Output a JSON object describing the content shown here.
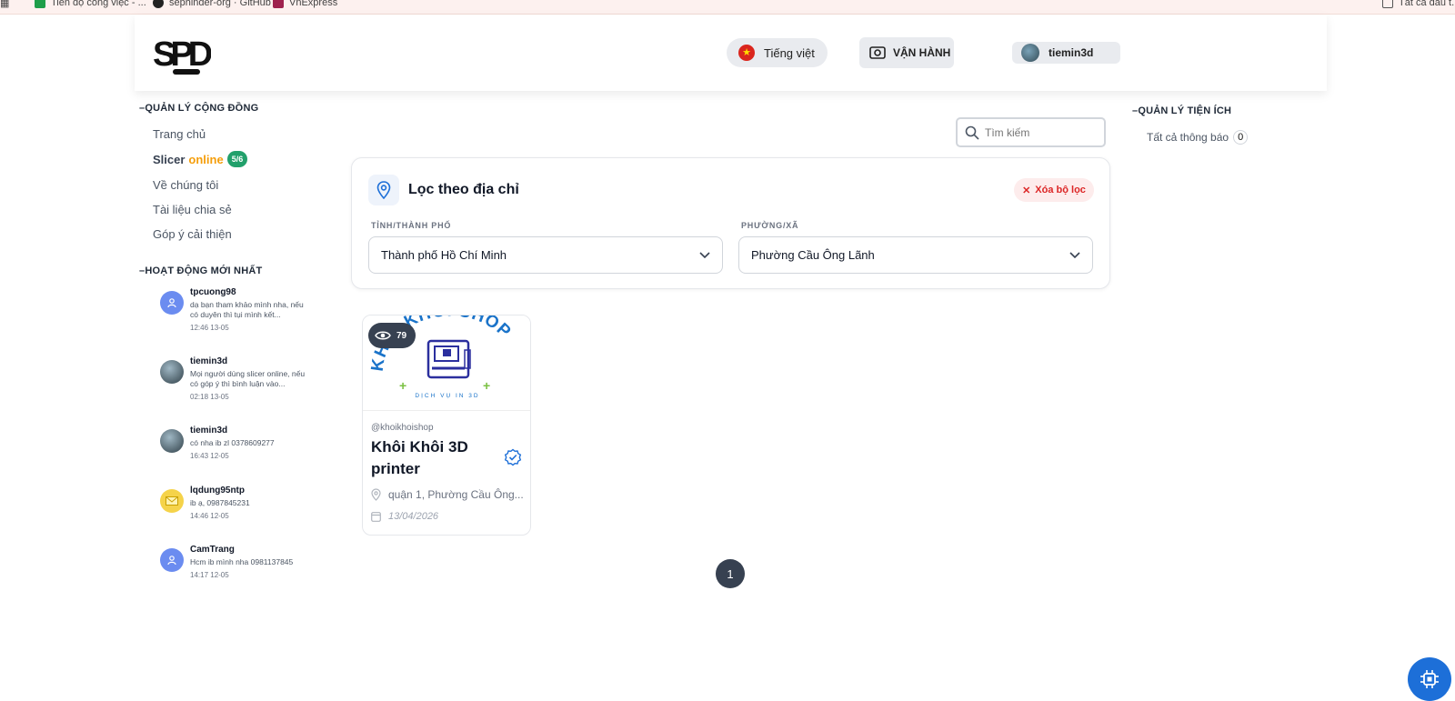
{
  "bookmarks": [
    {
      "label": "Tiến độ công việc - ..."
    },
    {
      "label": "sephinder-org · GitHub"
    },
    {
      "label": "VnExpress"
    },
    {
      "label": "Tất cả dấu t..."
    }
  ],
  "header": {
    "logo_text": "SPD",
    "language_label": "Tiếng việt",
    "operation_label": "VẬN HÀNH",
    "username": "tiemin3d"
  },
  "left_sidebar": {
    "community_title": "QUẢN LÝ CỘNG ĐỒNG",
    "nav": {
      "home": "Trang chủ",
      "slicer_prefix": "Slicer",
      "slicer_online": "online",
      "slicer_badge": "5/6",
      "about": "Về chúng tôi",
      "documents": "Tài liệu chia sẻ",
      "feedback": "Góp ý cải thiện"
    },
    "activity_title": "HOẠT ĐỘNG MỚI NHẤT",
    "activities": [
      {
        "name": "tpcuong98",
        "message": "dạ bạn tham khảo mình nha, nếu có duyên thì tụi mình kết...",
        "time": "12:46 13-05",
        "avatar": "person-icon"
      },
      {
        "name": "tiemin3d",
        "message": "Mọi người dùng slicer online, nếu có góp ý thì bình luận vào...",
        "time": "02:18 13-05",
        "avatar": "photo"
      },
      {
        "name": "tiemin3d",
        "message": "có nha ib zl 0378609277",
        "time": "16:43 12-05",
        "avatar": "photo"
      },
      {
        "name": "lqdung95ntp",
        "message": "ib ạ, 0987845231",
        "time": "14:46 12-05",
        "avatar": "envelope-icon"
      },
      {
        "name": "CamTrang",
        "message": "Hcm ib mình nha 0981137845",
        "time": "14:17 12-05",
        "avatar": "person-icon"
      }
    ]
  },
  "search": {
    "placeholder": "Tìm kiếm"
  },
  "filter": {
    "title": "Lọc theo địa chỉ",
    "clear_label": "Xóa bộ lọc",
    "province_label": "TỈNH/THÀNH PHỐ",
    "province_value": "Thành phố Hồ Chí Minh",
    "ward_label": "PHƯỜNG/XÃ",
    "ward_value": "Phường Cầu Ông Lãnh"
  },
  "shops": [
    {
      "logo_arc_text": "KHÔI KHÔI SHOP",
      "logo_sub_text": "DỊCH VỤ IN 3D",
      "views": "79",
      "handle": "@khoikhoishop",
      "title": "Khôi Khôi 3D printer",
      "address": "quận 1, Phường Cầu Ông...",
      "date": "13/04/2026"
    }
  ],
  "pagination": {
    "current": "1"
  },
  "right_sidebar": {
    "title": "QUẢN LÝ TIỆN ÍCH",
    "notifications_label": "Tất cả thông báo",
    "notifications_count": "0"
  },
  "colors": {
    "accent_blue": "#1d6fd8",
    "online_orange": "#f59e0b",
    "badge_green": "#22a06b",
    "danger_red": "#dc2626",
    "dark_gray": "#374151"
  }
}
